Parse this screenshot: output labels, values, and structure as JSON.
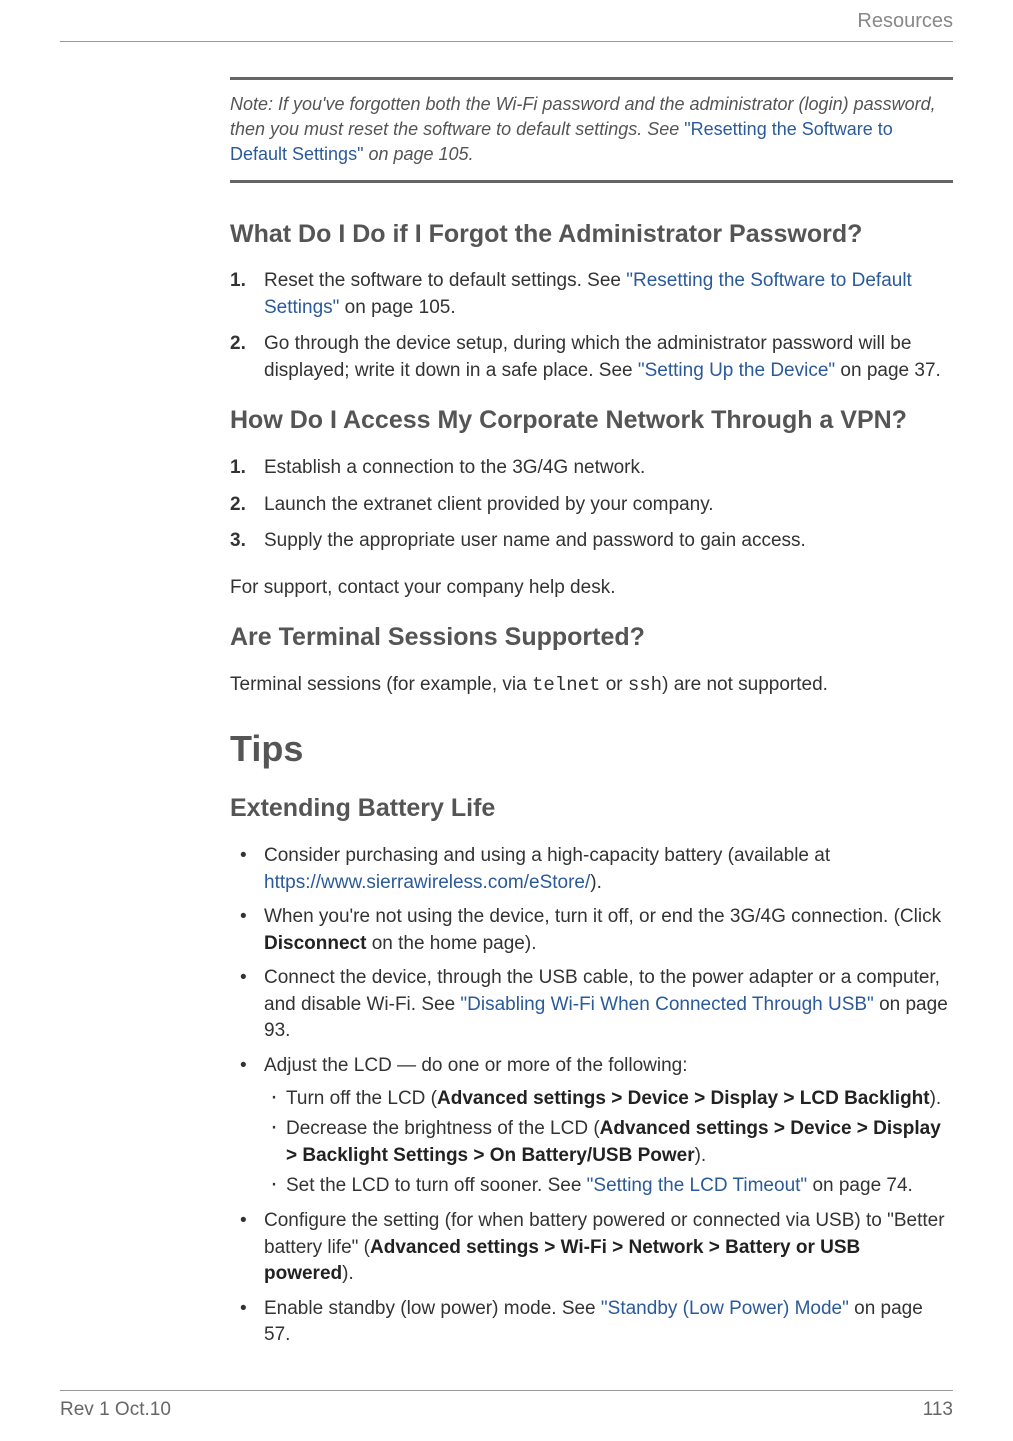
{
  "header": {
    "section": "Resources"
  },
  "note": {
    "prefix": "Note:  If you've forgotten both the Wi-Fi password and the administrator (login) password, then you must reset the software to default settings. See ",
    "link": "\"Resetting the Software to Default Settings\"",
    "suffix": " on page 105."
  },
  "section1": {
    "heading": "What Do I Do if I Forgot the Administrator Password?",
    "item1a": "Reset the software to default settings. See ",
    "item1link": "\"Resetting the Software to Default Settings\"",
    "item1b": " on page 105.",
    "item2a": "Go through the device setup, during which the administrator password will be displayed; write it down in a safe place. See ",
    "item2link": "\"Setting Up the Device\"",
    "item2b": " on page 37."
  },
  "section2": {
    "heading": "How Do I Access My Corporate Network Through a VPN?",
    "item1": "Establish a connection to the 3G/4G network.",
    "item2": "Launch the extranet client provided by your company.",
    "item3": "Supply the appropriate user name and password to gain access.",
    "para": "For support, contact your company help desk."
  },
  "section3": {
    "heading": "Are Terminal Sessions Supported?",
    "para_a": "Terminal sessions (for example, via ",
    "mono1": "telnet",
    "para_b": " or ",
    "mono2": "ssh",
    "para_c": ") are not supported."
  },
  "tips": {
    "heading": "Tips",
    "subheading": "Extending Battery Life",
    "b1a": "Consider purchasing and using a high-capacity battery (available at ",
    "b1link": "https://www.sierrawireless.com/eStore/",
    "b1b": ").",
    "b2a": "When you're not using the device, turn it off, or end the 3G/4G connection. (Click ",
    "b2ui": "Disconnect",
    "b2b": " on the home page).",
    "b3a": "Connect the device, through the USB cable, to the power adapter or a computer, and disable Wi-Fi. See ",
    "b3link": "\"Disabling Wi-Fi When Connected Through USB\"",
    "b3b": " on page 93.",
    "b4": "Adjust the LCD — do one or more of the following:",
    "b4s1a": "Turn off the LCD (",
    "b4s1ui": "Advanced settings > Device > Display > LCD Backlight",
    "b4s1b": ").",
    "b4s2a": "Decrease the brightness of the LCD (",
    "b4s2ui": "Advanced settings > Device > Display > Backlight Settings > On Battery/USB Power",
    "b4s2b": ").",
    "b4s3a": "Set the LCD to turn off sooner. See ",
    "b4s3link": "\"Setting the LCD Timeout\"",
    "b4s3b": " on page 74.",
    "b5a": "Configure the setting (for when battery powered or connected via USB) to \"Better battery life\" (",
    "b5ui": "Advanced settings > Wi-Fi > Network > Battery or USB powered",
    "b5b": ").",
    "b6a": "Enable standby (low power) mode. See ",
    "b6link": "\"Standby (Low Power) Mode\"",
    "b6b": " on page 57."
  },
  "footer": {
    "left": "Rev 1  Oct.10",
    "right": "113"
  }
}
